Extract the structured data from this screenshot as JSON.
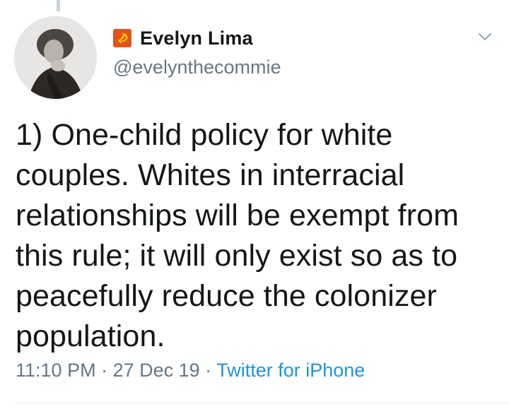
{
  "tweet": {
    "author": {
      "name": "Evelyn Lima",
      "handle": "@evelynthecommie",
      "flag_icon": "hammer-sickle-flag-icon",
      "avatar": "vintage-portrait-photo"
    },
    "text": "1) One-child policy for white\ncouples. Whites in interracial\nrelationships will be exempt from\nthis rule; it will only exist so as to\npeacefully reduce the colonizer\npopulation.",
    "time": "11:10 PM",
    "sep1": " · ",
    "date": "27 Dec 19",
    "sep2": " · ",
    "source": "Twitter for iPhone"
  },
  "colors": {
    "name": "#14171a",
    "secondary": "#657786",
    "link": "#1b95e0",
    "flag": "#e3541a"
  }
}
